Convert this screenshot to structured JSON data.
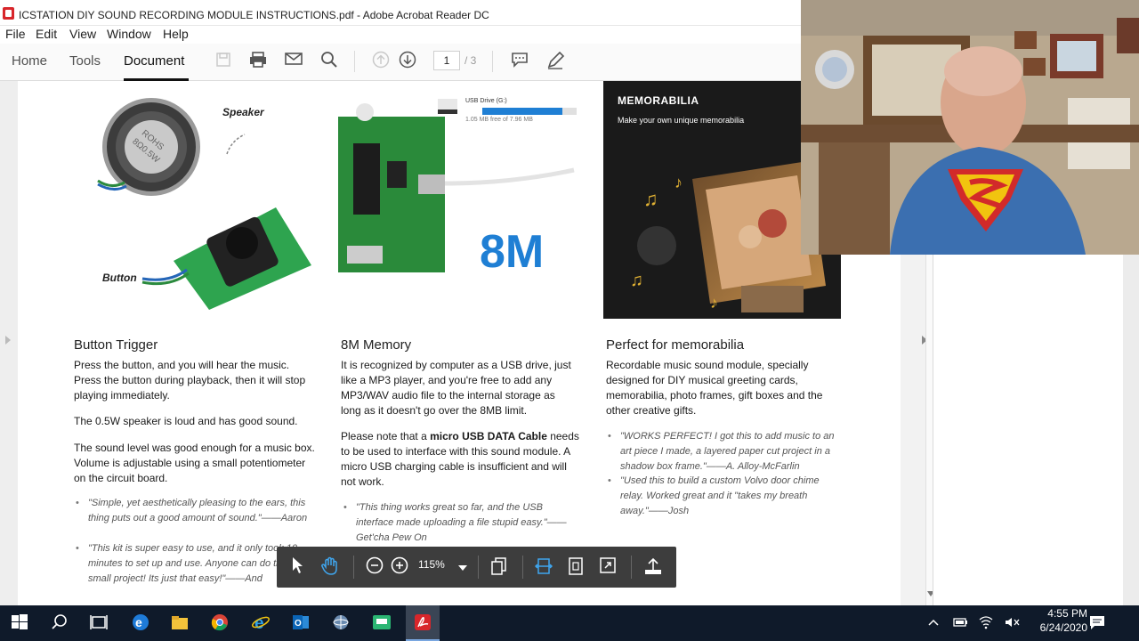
{
  "window": {
    "title": "ICSTATION DIY SOUND RECORDING MODULE INSTRUCTIONS.pdf - Adobe Acrobat Reader DC"
  },
  "menu": [
    "File",
    "Edit",
    "View",
    "Window",
    "Help"
  ],
  "tabs": {
    "home": "Home",
    "tools": "Tools",
    "document": "Document"
  },
  "toolbar": {
    "page_current": "1",
    "page_total": "/ 3"
  },
  "images": {
    "speaker_label": "Speaker",
    "button_label": "Button",
    "usb_drive": "USB Drive (G:)",
    "usb_free": "1.05 MB free of 7.96 MB",
    "memory_big": "8M",
    "memorabilia_title": "MEMORABILIA",
    "memorabilia_sub": "Make your own unique memorabilia"
  },
  "col1": {
    "title": "Button Trigger",
    "p1": "Press the button, and you will hear the music. Press the button during playback, then it will stop playing immediately.",
    "p2": "The 0.5W speaker is loud and has good sound.",
    "p3": "The sound level was good enough for a music box. Volume is adjustable using a small potentiometer on the circuit board.",
    "q1": "\"Simple, yet aesthetically pleasing to the ears, this thing puts out a good amount of sound.\"——Aaron",
    "q2": "\"This kit is super easy to use, and it only took 10 minutes to set up and use. Anyone can do this small project! Its just that easy!\"——And"
  },
  "col2": {
    "title": "8M Memory",
    "p1": "It is recognized by computer as a USB drive, just like a MP3 player, and you're free to add any MP3/WAV audio file to the internal storage as long as it doesn't go over the 8MB limit.",
    "p2_a": "Please note that a ",
    "p2_b": "micro USB DATA Cable",
    "p2_c": " needs to be used to interface with this sound module. A micro USB charging cable is insufficient and will not work.",
    "q1": "\"This thing works great so far, and the USB interface made uploading a file stupid easy.\"——Get'cha Pew On"
  },
  "col3": {
    "title": "Perfect for memorabilia",
    "p1": "Recordable music sound module, specially designed for DIY musical greeting cards, memorabilia, photo frames, gift boxes and the other creative gifts.",
    "q1": "\"WORKS PERFECT! I got this to add music to an art piece I made, a layered paper cut project in a shadow box frame.\"——A. Alloy-McFarlin",
    "q2": "\"Used this to build a custom Volvo door chime relay. Worked great and it \"takes my breath away.\"——Josh"
  },
  "floating_toolbar": {
    "zoom": "115%"
  },
  "taskbar": {
    "time": "4:55 PM",
    "date": "6/24/2020"
  },
  "colors": {
    "accent_blue": "#2b7bd6",
    "acrobat_red": "#d8262b",
    "taskbar": "#0f1a2a"
  }
}
